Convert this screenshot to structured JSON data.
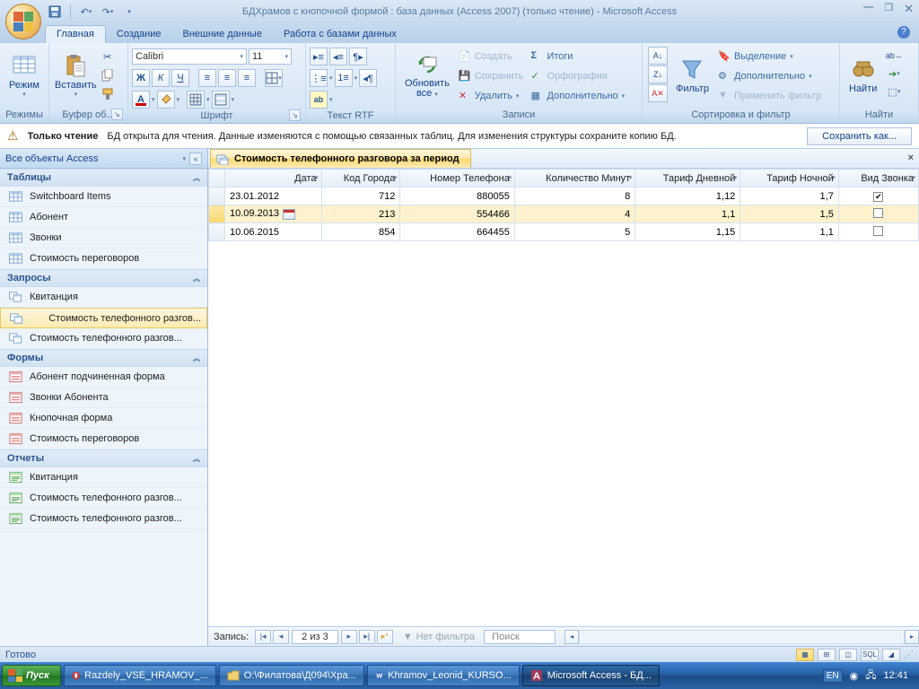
{
  "titlebar": {
    "title": "БДХрамов с кнопочной формой : база данных (Access 2007) (только чтение) - Microsoft Access"
  },
  "ribbon_tabs": {
    "items": [
      "Главная",
      "Создание",
      "Внешние данные",
      "Работа с базами данных"
    ],
    "active": 0
  },
  "ribbon": {
    "group_views": {
      "label": "Режимы",
      "btn": "Режим"
    },
    "group_clipboard": {
      "label": "Буфер об...",
      "btn": "Вставить"
    },
    "group_font": {
      "label": "Шрифт",
      "name": "Calibri",
      "size": "11"
    },
    "group_richtext": {
      "label": "Текст RTF"
    },
    "group_records": {
      "label": "Записи",
      "refresh": "Обновить\nвсе",
      "new": "Создать",
      "save": "Сохранить",
      "delete": "Удалить",
      "totals": "Итоги",
      "spelling": "Орфография",
      "more": "Дополнительно"
    },
    "group_sortfilter": {
      "label": "Сортировка и фильтр",
      "filter": "Фильтр",
      "selection": "Выделение",
      "advanced": "Дополнительно",
      "toggle": "Применить фильтр"
    },
    "group_find": {
      "label": "Найти",
      "find": "Найти"
    }
  },
  "msgbar": {
    "tag": "Только чтение",
    "text": "БД открыта для чтения. Данные изменяются с помощью связанных таблиц. Для изменения структуры сохраните копию БД.",
    "btn": "Сохранить как..."
  },
  "navpane": {
    "header": "Все объекты Access",
    "cats": [
      {
        "name": "Таблицы",
        "items": [
          "Switchboard Items",
          "Абонент",
          "Звонки",
          "Стоимость переговоров"
        ]
      },
      {
        "name": "Запросы",
        "items": [
          "Квитанция",
          "Стоимость телефонного разгов...",
          "Стоимость телефонного разгов..."
        ],
        "sel": 1
      },
      {
        "name": "Формы",
        "items": [
          "Абонент подчиненная форма",
          "Звонки Абонента",
          "Кнопочная форма",
          "Стоимость переговоров"
        ]
      },
      {
        "name": "Отчеты",
        "items": [
          "Квитанция",
          "Стоимость телефонного разгов...",
          "Стоимость телефонного разгов..."
        ]
      }
    ]
  },
  "doctab": {
    "title": "Стоимость телефонного разговора за период"
  },
  "grid": {
    "columns": [
      "Дата",
      "Код Города",
      "Номер Телефона",
      "Количество Минут",
      "Тариф Дневной",
      "Тариф Ночной",
      "Вид Звонка"
    ],
    "rows": [
      {
        "date": "23.01.2012",
        "city": "712",
        "phone": "880055",
        "mins": "8",
        "day": "1,12",
        "night": "1,7",
        "chk": true
      },
      {
        "date": "10.09.2013",
        "city": "213",
        "phone": "554466",
        "mins": "4",
        "day": "1,1",
        "night": "1,5",
        "chk": false
      },
      {
        "date": "10.06.2015",
        "city": "854",
        "phone": "664455",
        "mins": "5",
        "day": "1,15",
        "night": "1,1",
        "chk": false
      }
    ],
    "selrow": 1
  },
  "recnav": {
    "label": "Запись:",
    "pos": "2 из 3",
    "nofilter": "Нет фильтра",
    "search": "Поиск"
  },
  "statusbar": {
    "text": "Готово",
    "sql": "SQL"
  },
  "taskbar": {
    "start": "Пуск",
    "items": [
      {
        "label": "Razdely_VSE_HRAMOV_...",
        "type": "opera"
      },
      {
        "label": "О:\\Филатова\\Д094\\Хра...",
        "type": "folder"
      },
      {
        "label": "Khramov_Leonid_KURSO...",
        "type": "word"
      },
      {
        "label": "Microsoft Access - БД...",
        "type": "access",
        "active": true
      }
    ],
    "lang": "EN",
    "time": "12:41"
  }
}
